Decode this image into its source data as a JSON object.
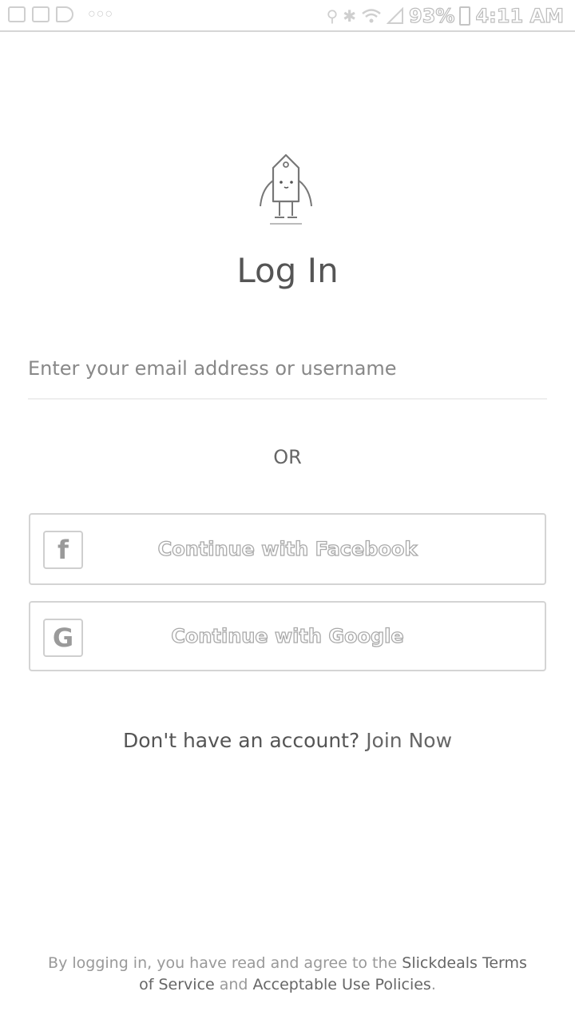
{
  "status_bar": {
    "battery": "93%",
    "time": "4:11 AM",
    "overflow_dots": "○○○"
  },
  "login": {
    "title": "Log In",
    "email_placeholder": "Enter your email address or username",
    "email_value": "",
    "separator": "OR",
    "facebook_button": "Continue with Facebook",
    "facebook_icon_glyph": "f",
    "google_button": "Continue with Google",
    "google_icon_glyph": "G",
    "signup_prompt": "Don't have an account?",
    "signup_link": "Join Now"
  },
  "footer": {
    "prefix": "By logging in, you have read and agree to the",
    "terms_link": "Slickdeals Terms of Service",
    "conjunction": "and",
    "policy_link": "Acceptable Use Policies",
    "suffix": "."
  },
  "icons": {
    "status_left": [
      "photo-notification-icon",
      "gmail-notification-icon",
      "play-notification-icon"
    ],
    "status_right": [
      "location-icon",
      "bluetooth-icon",
      "wifi-icon",
      "signal-icon",
      "battery-icon"
    ],
    "logo": "slickdeals-tag-mascot-icon"
  }
}
